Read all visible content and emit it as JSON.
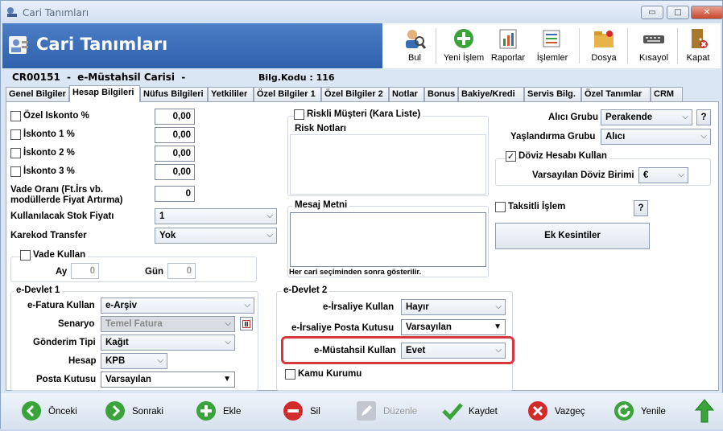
{
  "window": {
    "title": "Cari Tanımları",
    "minimize": "▭",
    "maximize": "□",
    "close": "✕"
  },
  "header": {
    "title": "Cari Tanımları"
  },
  "toolbar": [
    {
      "label": "Bul",
      "icon": "search-person-icon"
    },
    {
      "label": "Yeni İşlem",
      "icon": "plus-circle-icon"
    },
    {
      "label": "Raporlar",
      "icon": "report-icon"
    },
    {
      "label": "İşlemler",
      "icon": "operations-icon"
    },
    {
      "label": "Dosya",
      "icon": "file-icon"
    },
    {
      "label": "Kısayol",
      "icon": "keyboard-icon"
    },
    {
      "label": "Kapat",
      "icon": "exit-door-icon"
    }
  ],
  "record": {
    "code": "CR00151",
    "separator": "-",
    "name": "e-Müstahsil Carisi",
    "dash": "-",
    "bilgkodu": "Bilg.Kodu : 116"
  },
  "tabs": [
    "Genel Bilgiler",
    "Hesap Bilgileri",
    "Nüfus Bilgileri",
    "Yetkililer",
    "Özel Bilgiler 1",
    "Özel Bilgiler 2",
    "Notlar",
    "Bonus",
    "Bakiye/Kredi",
    "Servis Bilg.",
    "Özel Tanımlar",
    "CRM"
  ],
  "active_tab": "Hesap Bilgileri",
  "left": {
    "ozel_iskonto": {
      "label": "Özel Iskonto %",
      "value": "0,00"
    },
    "iskonto1": {
      "label": "İskonto 1 %",
      "value": "0,00"
    },
    "iskonto2": {
      "label": "İskonto 2 %",
      "value": "0,00"
    },
    "iskonto3": {
      "label": "İskonto 3 %",
      "value": "0,00"
    },
    "vade_orani": {
      "label1": "Vade Oranı (Ft.İrs vb.",
      "label2": "modüllerde Fiyat Artırma)",
      "value": "0"
    },
    "stok_fiyati": {
      "label": "Kullanılacak Stok Fiyatı",
      "value": "1"
    },
    "karekod": {
      "label": "Karekod Transfer",
      "value": "Yok"
    },
    "vade_kullan": {
      "label": "Vade Kullan",
      "ay_label": "Ay",
      "ay": "0",
      "gun_label": "Gün",
      "gun": "0"
    }
  },
  "edevlet1": {
    "title": "e-Devlet 1",
    "efatura": {
      "label": "e-Fatura Kullan",
      "value": "e-Arşiv"
    },
    "senaryo": {
      "label": "Senaryo",
      "value": "Temel Fatura"
    },
    "gonderim": {
      "label": "Gönderim Tipi",
      "value": "Kağıt"
    },
    "hesap": {
      "label": "Hesap",
      "value": "KPB"
    },
    "posta": {
      "label": "Posta Kutusu",
      "value": "Varsayılan"
    }
  },
  "middle": {
    "riskli": {
      "label": "Riskli Müşteri (Kara Liste)"
    },
    "risk_notlari": "Risk Notları",
    "mesaj": {
      "title": "Mesaj Metni",
      "note": "Her cari seçiminden sonra gösterilir."
    }
  },
  "edevlet2": {
    "title": "e-Devlet 2",
    "eirsaliye": {
      "label": "e-İrsaliye Kullan",
      "value": "Hayır"
    },
    "eirsaliye_posta": {
      "label": "e-İrsaliye Posta Kutusu",
      "value": "Varsayılan"
    },
    "emustahsil": {
      "label": "e-Müstahsil Kullan",
      "value": "Evet"
    },
    "kamu": {
      "label": "Kamu Kurumu"
    }
  },
  "right": {
    "alici_grubu": {
      "label": "Alıcı Grubu",
      "value": "Perakende",
      "help": "?"
    },
    "yaslandirma": {
      "label": "Yaşlandırma Grubu",
      "value": "Alıcı"
    },
    "doviz": {
      "label": "Döviz Hesabı Kullan",
      "birim_label": "Varsayılan Döviz Birimi",
      "birim": "€"
    },
    "taksitli": {
      "label": "Taksitli İşlem",
      "help": "?"
    },
    "ek_kesintiler": "Ek Kesintiler"
  },
  "footer": [
    {
      "label": "Önceki",
      "color": "#3aa33a",
      "glyph": "◀"
    },
    {
      "label": "Sonraki",
      "color": "#3aa33a",
      "glyph": "▶"
    },
    {
      "label": "Ekle",
      "color": "#3aa33a",
      "glyph": "+"
    },
    {
      "label": "Sil",
      "color": "#d22b2b",
      "glyph": "−"
    },
    {
      "label": "Düzenle",
      "color": "#b9bec6",
      "glyph": "✎"
    },
    {
      "label": "Kaydet",
      "color": "#3aa33a",
      "glyph": "✔"
    },
    {
      "label": "Vazgeç",
      "color": "#d22b2b",
      "glyph": "✖"
    },
    {
      "label": "Yenile",
      "color": "#3aa33a",
      "glyph": "↻"
    }
  ]
}
